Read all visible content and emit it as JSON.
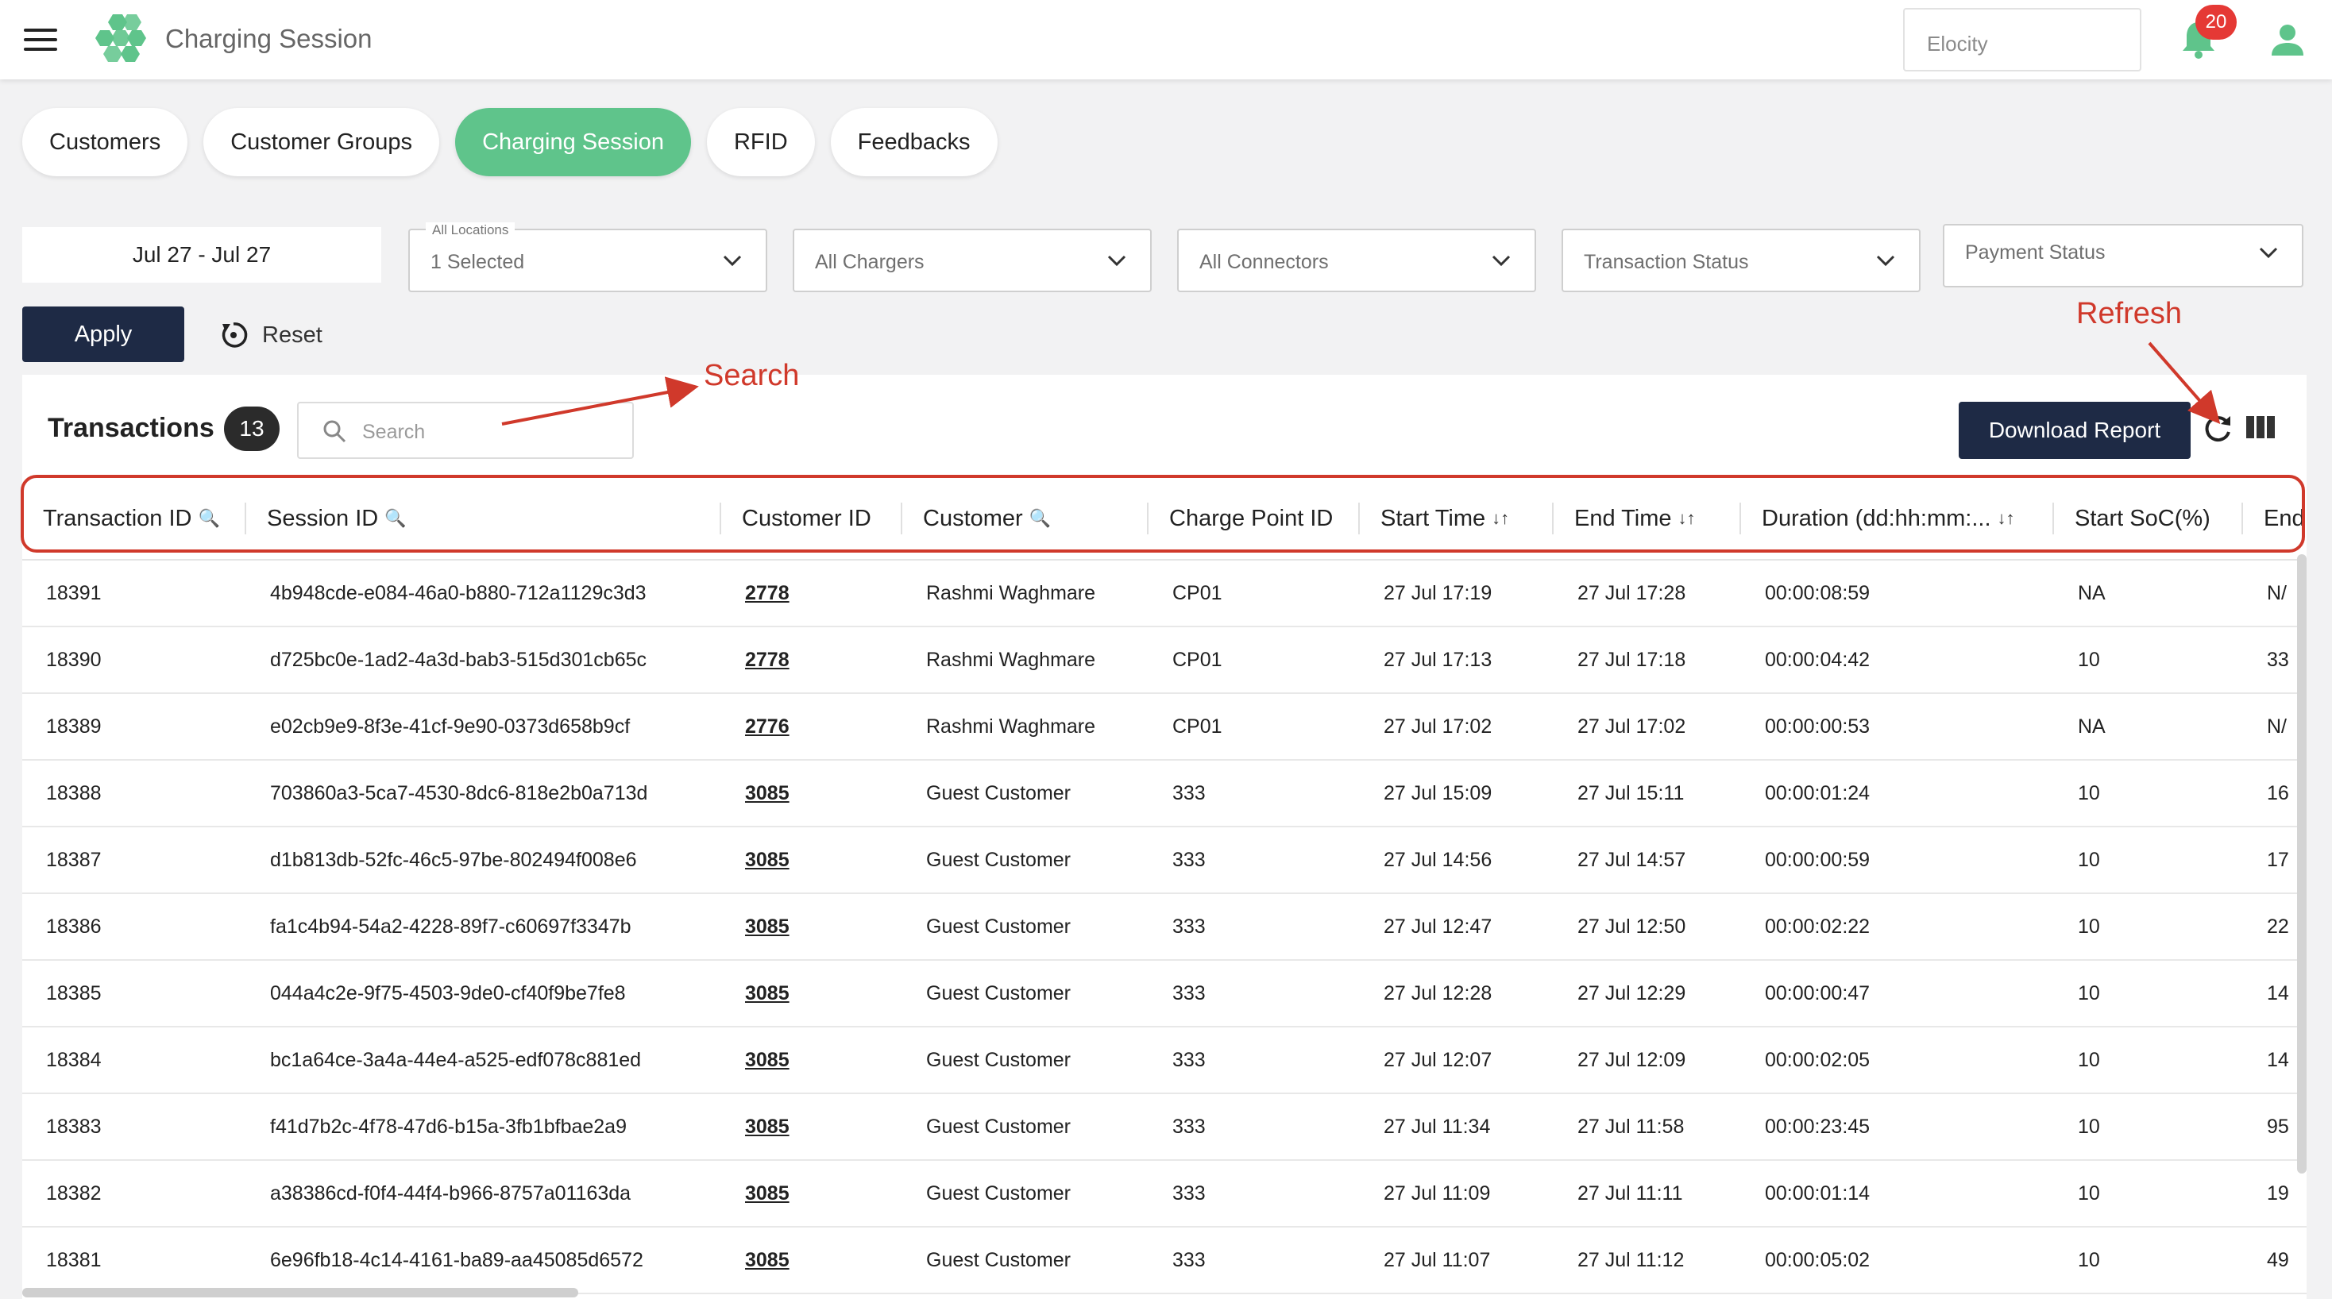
{
  "header": {
    "title": "Charging Session",
    "org_select": "Elocity",
    "notification_count": "20",
    "brand_color": "#5fc48b"
  },
  "tabs": [
    {
      "label": "Customers"
    },
    {
      "label": "Customer Groups"
    },
    {
      "label": "Charging Session",
      "active": true
    },
    {
      "label": "RFID"
    },
    {
      "label": "Feedbacks"
    }
  ],
  "filters": {
    "date_range": "Jul 27 - Jul 27",
    "locations_label": "All Locations",
    "locations_value": "1 Selected",
    "chargers": "All Chargers",
    "connectors": "All Connectors",
    "transaction_status": "Transaction Status",
    "payment_status": "Payment Status",
    "apply": "Apply",
    "reset": "Reset"
  },
  "transactions": {
    "title": "Transactions",
    "count": "13",
    "search_placeholder": "Search",
    "download_label": "Download Report"
  },
  "annotations": {
    "search": "Search",
    "refresh": "Refresh",
    "color": "#d0392b"
  },
  "columns": [
    {
      "label": "Transaction ID",
      "icon": "search-icon"
    },
    {
      "label": "Session ID",
      "icon": "search-icon"
    },
    {
      "label": "Customer ID"
    },
    {
      "label": "Customer",
      "icon": "search-icon"
    },
    {
      "label": "Charge Point ID"
    },
    {
      "label": "Start Time",
      "icon": "sort-icon"
    },
    {
      "label": "End Time",
      "icon": "sort-icon"
    },
    {
      "label": "Duration (dd:hh:mm:...",
      "icon": "sort-icon"
    },
    {
      "label": "Start SoC(%)"
    },
    {
      "label": "End"
    }
  ],
  "rows": [
    [
      "18391",
      "4b948cde-e084-46a0-b880-712a1129c3d3",
      "2778",
      "Rashmi Waghmare",
      "CP01",
      "27 Jul 17:19",
      "27 Jul 17:28",
      "00:00:08:59",
      "NA",
      "N/"
    ],
    [
      "18390",
      "d725bc0e-1ad2-4a3d-bab3-515d301cb65c",
      "2778",
      "Rashmi Waghmare",
      "CP01",
      "27 Jul 17:13",
      "27 Jul 17:18",
      "00:00:04:42",
      "10",
      "33"
    ],
    [
      "18389",
      "e02cb9e9-8f3e-41cf-9e90-0373d658b9cf",
      "2776",
      "Rashmi Waghmare",
      "CP01",
      "27 Jul 17:02",
      "27 Jul 17:02",
      "00:00:00:53",
      "NA",
      "N/"
    ],
    [
      "18388",
      "703860a3-5ca7-4530-8dc6-818e2b0a713d",
      "3085",
      "Guest Customer",
      "333",
      "27 Jul 15:09",
      "27 Jul 15:11",
      "00:00:01:24",
      "10",
      "16"
    ],
    [
      "18387",
      "d1b813db-52fc-46c5-97be-802494f008e6",
      "3085",
      "Guest Customer",
      "333",
      "27 Jul 14:56",
      "27 Jul 14:57",
      "00:00:00:59",
      "10",
      "17"
    ],
    [
      "18386",
      "fa1c4b94-54a2-4228-89f7-c60697f3347b",
      "3085",
      "Guest Customer",
      "333",
      "27 Jul 12:47",
      "27 Jul 12:50",
      "00:00:02:22",
      "10",
      "22"
    ],
    [
      "18385",
      "044a4c2e-9f75-4503-9de0-cf40f9be7fe8",
      "3085",
      "Guest Customer",
      "333",
      "27 Jul 12:28",
      "27 Jul 12:29",
      "00:00:00:47",
      "10",
      "14"
    ],
    [
      "18384",
      "bc1a64ce-3a4a-44e4-a525-edf078c881ed",
      "3085",
      "Guest Customer",
      "333",
      "27 Jul 12:07",
      "27 Jul 12:09",
      "00:00:02:05",
      "10",
      "14"
    ],
    [
      "18383",
      "f41d7b2c-4f78-47d6-b15a-3fb1bfbae2a9",
      "3085",
      "Guest Customer",
      "333",
      "27 Jul 11:34",
      "27 Jul 11:58",
      "00:00:23:45",
      "10",
      "95"
    ],
    [
      "18382",
      "a38386cd-f0f4-44f4-b966-8757a01163da",
      "3085",
      "Guest Customer",
      "333",
      "27 Jul 11:09",
      "27 Jul 11:11",
      "00:00:01:14",
      "10",
      "19"
    ],
    [
      "18381",
      "6e96fb18-4c14-4161-ba89-aa45085d6572",
      "3085",
      "Guest Customer",
      "333",
      "27 Jul 11:07",
      "27 Jul 11:12",
      "00:00:05:02",
      "10",
      "49"
    ]
  ]
}
